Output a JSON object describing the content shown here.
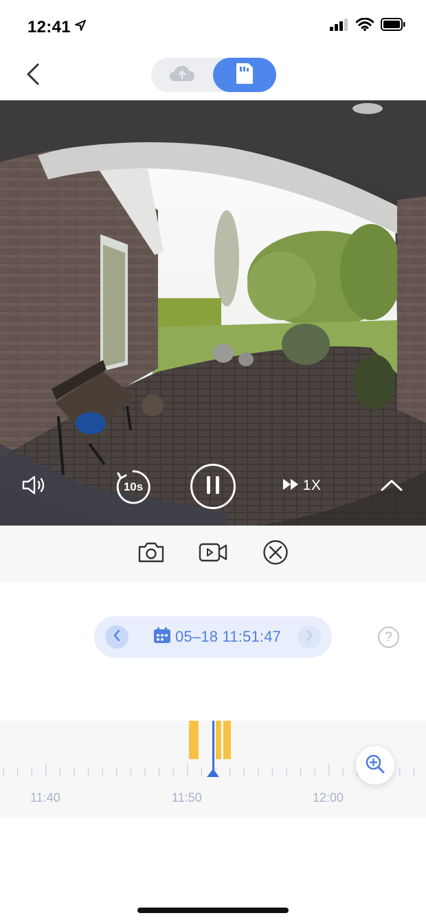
{
  "status_bar": {
    "time": "12:41",
    "icons": [
      "location-arrow-icon",
      "signal-icon",
      "wifi-icon",
      "battery-icon"
    ]
  },
  "header": {
    "back_icon": "chevron-left-icon",
    "segments": [
      {
        "name": "cloud",
        "icon": "cloud-icon",
        "selected": false
      },
      {
        "name": "sd-card",
        "icon": "sd-card-icon",
        "selected": true
      }
    ]
  },
  "player": {
    "controls": {
      "volume_icon": "speaker-icon",
      "rewind_label": "10s",
      "pause_icon": "pause-icon",
      "speed_label": "1X",
      "expand_icon": "chevron-up-icon"
    }
  },
  "actions": [
    {
      "name": "snapshot",
      "icon": "camera-icon"
    },
    {
      "name": "record",
      "icon": "video-record-icon"
    },
    {
      "name": "delete",
      "icon": "close-circle-icon"
    }
  ],
  "date_selector": {
    "datetime": "05–18 11:51:47",
    "calendar_icon": "calendar-icon"
  },
  "help": {
    "label": "?"
  },
  "timeline": {
    "tick_labels": [
      "11:40",
      "11:50",
      "12:00"
    ],
    "playhead_time": "11:51:47",
    "zoom_icon": "zoom-in-icon"
  },
  "colors": {
    "accent": "#4f86ec",
    "event": "#f7c244",
    "playhead": "#3a6fd8",
    "pill_bg": "#e8eefb"
  }
}
